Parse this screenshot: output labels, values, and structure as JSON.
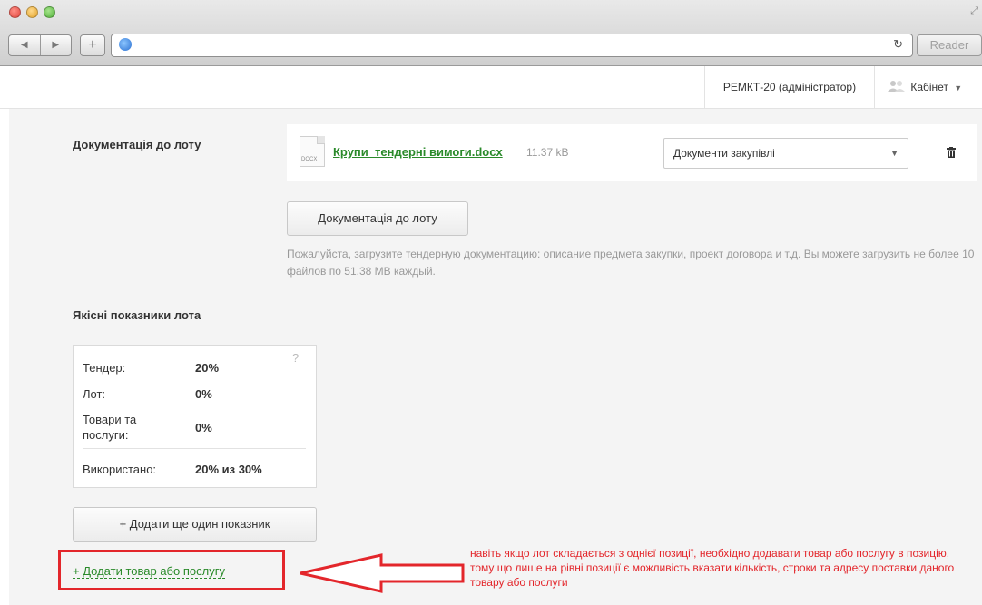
{
  "browser": {
    "reader_label": "Reader"
  },
  "header": {
    "user_label": "РЕМКТ-20 (адміністратор)",
    "cabinet_label": "Кабінет"
  },
  "docs": {
    "section_label": "Документація до лоту",
    "file_name": "Крупи_тендерні вимоги.docx",
    "file_size": "11.37 kB",
    "file_type_badge": "DOCX",
    "doc_type_selected": "Документи закупівлі",
    "upload_button": "Документація до лоту",
    "hint": "Пожалуйста, загрузите тендерную документацию: описание предмета закупки, проект договора и т.д. Вы можете загрузить не более 10 файлов по 51.38 MB каждый."
  },
  "quality": {
    "section_label": "Якісні показники лота",
    "help": "?",
    "rows": [
      {
        "label": "Тендер:",
        "value": "20%"
      },
      {
        "label": "Лот:",
        "value": "0%"
      },
      {
        "label": "Товари та послуги:",
        "value": "0%"
      }
    ],
    "used_label": "Використано:",
    "used_value": "20% из 30%",
    "add_indicator_button": "+ Додати ще один показник"
  },
  "add_item_link": "+ Додати товар або послугу",
  "annotation": "навіть якщо лот складається з однієї позиції, необхідно додавати товар або послугу в позицію, тому що лише на рівні позиції є можливість вказати кількість, строки та адресу поставки даного товару або послуги",
  "colors": {
    "link_green": "#2a8a2a",
    "annotation_red": "#e3262b"
  }
}
